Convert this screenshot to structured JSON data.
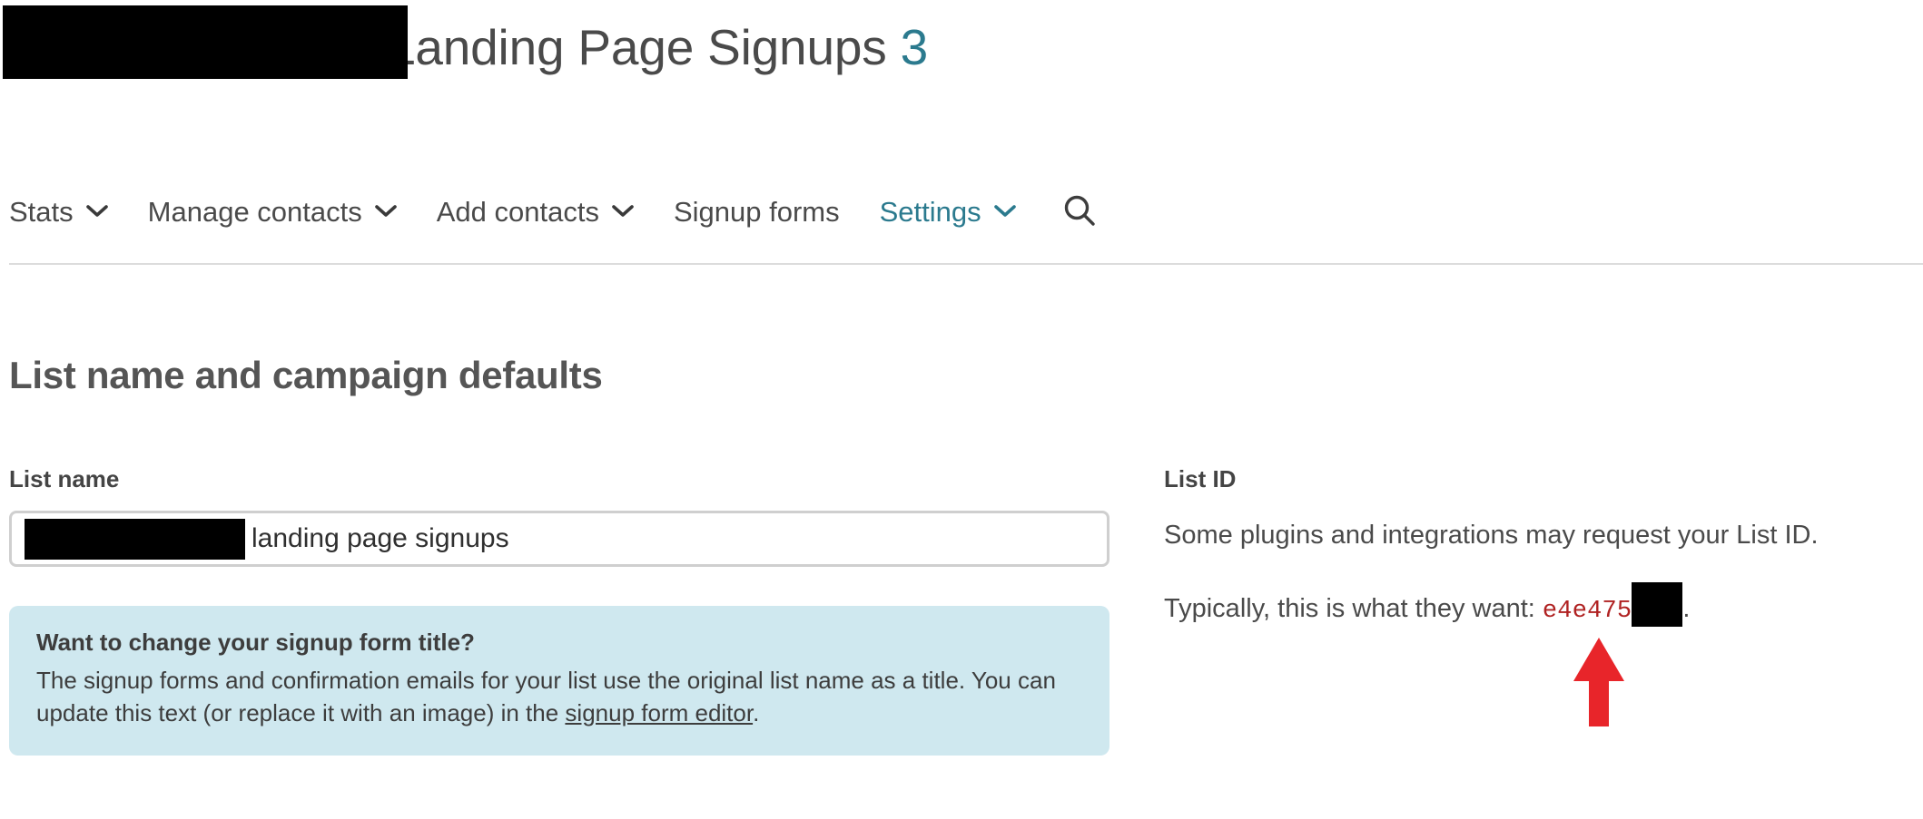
{
  "header": {
    "title_redacted": true,
    "title_suffix": "Landing Page Signups",
    "count": "3",
    "count_color": "#2b7a8e"
  },
  "nav": {
    "items": [
      {
        "label": "Stats",
        "has_dropdown": true,
        "active": false
      },
      {
        "label": "Manage contacts",
        "has_dropdown": true,
        "active": false
      },
      {
        "label": "Add contacts",
        "has_dropdown": true,
        "active": false
      },
      {
        "label": "Signup forms",
        "has_dropdown": false,
        "active": false
      },
      {
        "label": "Settings",
        "has_dropdown": true,
        "active": true
      }
    ],
    "search_icon": "search-icon",
    "chevron_icon": "chevron-down-icon",
    "active_color": "#2b7a8e"
  },
  "page": {
    "section_heading": "List name and campaign defaults"
  },
  "list_name": {
    "label": "List name",
    "value_redacted": true,
    "value_visible": "landing page signups"
  },
  "callout": {
    "title": "Want to change your signup form title?",
    "body_before_link": "The signup forms and confirmation emails for your list use the original list name as a title. You can update this text (or replace it with an image) in the ",
    "link_text": "signup form editor",
    "body_after_link": ".",
    "background_color": "#cfe8ef"
  },
  "list_id": {
    "label": "List ID",
    "description": "Some plugins and integrations may request your List ID.",
    "prefix_text": "Typically, this is what they want: ",
    "id_visible": "e4e475",
    "id_redacted": true,
    "suffix_text": ".",
    "id_color": "#b02222"
  },
  "annotation": {
    "type": "arrow-up",
    "color": "#e8252a",
    "points_at": "list-id-value"
  }
}
